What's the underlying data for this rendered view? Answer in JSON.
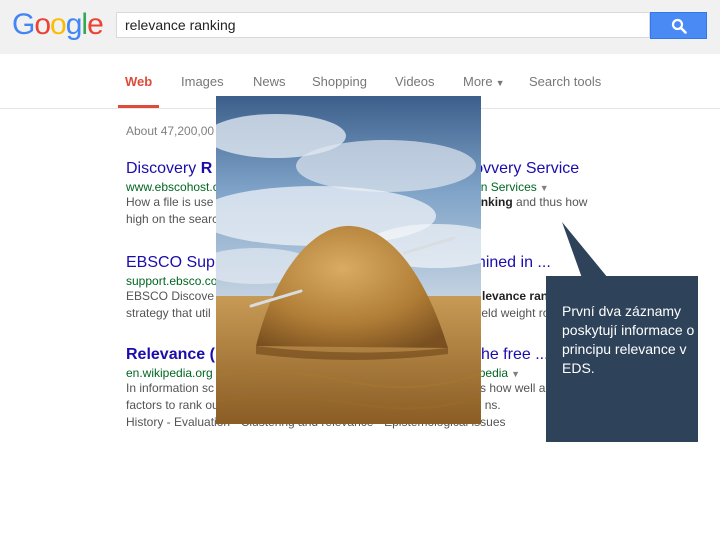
{
  "logo": {
    "text": "Google"
  },
  "search": {
    "query": "relevance ranking"
  },
  "tabs": [
    {
      "label": "Web"
    },
    {
      "label": "Images"
    },
    {
      "label": "News"
    },
    {
      "label": "Shopping"
    },
    {
      "label": "Videos"
    },
    {
      "label": "More"
    },
    {
      "label": "Search tools"
    }
  ],
  "results_stats": "About 47,200,00",
  "results": [
    {
      "title_a": "Discovery ",
      "title_b": "R",
      "title_c": "ovvery Service",
      "url_a": "www.ebscohost.c",
      "url_b": "n Services",
      "snippet1_a": "How a file is use",
      "snippet1_b": "ranking",
      "snippet1_c": " and thus how",
      "snippet2": "high on the searc"
    },
    {
      "title_a": "EBSCO Supp",
      "title_c": "termined in ...",
      "url_a": "support.ebsco.co",
      "snippet1_a": "EBSCO Discove",
      "snippet1_b": "levance ranking",
      "snippet2_a": "strategy that util",
      "snippet2_b": "ield weight ro"
    },
    {
      "title_a": "Relevance (",
      "title_c": "he free ...",
      "url_a": "en.wikipedia.org",
      "url_b": "pedia",
      "snippet1_a": "In information sc",
      "snippet1_b": "s how well a",
      "snippet2_a": "factors to rank ou",
      "snippet2_b": "ns.",
      "snippet3": "History - Evaluation - Clustering and relevance - Epistemological issues"
    }
  ],
  "callout": {
    "text": "První dva záznamy poskytují informace o principu relevance v EDS."
  },
  "colors": {
    "header_bg": "#f1f1f1",
    "search_button": "#4a8af4",
    "active_tab": "#dd4b39",
    "link": "#1a0dab",
    "url": "#006621",
    "callout_bg": "#2e4259"
  }
}
